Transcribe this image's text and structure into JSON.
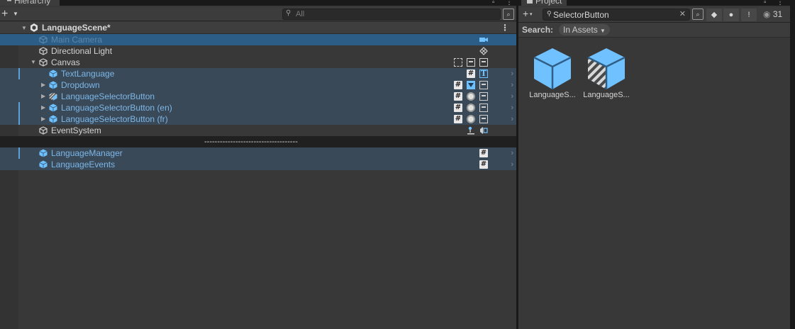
{
  "colors": {
    "panel_bg": "#383838",
    "selection": "#2c5d87",
    "highlight_row": "#3a4958",
    "prefab_blue": "#7cb7e8",
    "cube_blue": "#6fc1ff"
  },
  "hierarchy": {
    "tab_title": "Hierarchy",
    "search_placeholder": "All",
    "scene": {
      "name": "LanguageScene*",
      "icon": "unity-scene-icon"
    },
    "rows": [
      {
        "label": "Main Camera",
        "style": "dim",
        "icon": "gameobject-icon",
        "components": [
          "camera-icon"
        ]
      },
      {
        "label": "Directional Light",
        "style": "white",
        "icon": "gameobject-icon",
        "components": [
          "light-icon"
        ]
      },
      {
        "label": "Canvas",
        "style": "white",
        "icon": "gameobject-icon",
        "components": [
          "rect-transform-icon",
          "canvas-icon",
          "canvas-scaler-icon"
        ]
      },
      {
        "label": "TextLanguage",
        "style": "blue",
        "icon": "prefab-icon",
        "components": [
          "script-icon",
          "text-icon"
        ]
      },
      {
        "label": "Dropdown",
        "style": "blue",
        "icon": "prefab-icon",
        "components": [
          "script-icon",
          "dropdown-icon",
          "image-icon"
        ]
      },
      {
        "label": "LanguageSelectorButton",
        "style": "blue",
        "icon": "prefab-variant-icon",
        "components": [
          "script-icon",
          "toggle-icon",
          "image-icon"
        ]
      },
      {
        "label": "LanguageSelectorButton (en)",
        "style": "blue",
        "icon": "prefab-icon",
        "components": [
          "script-icon",
          "toggle-icon",
          "image-icon"
        ]
      },
      {
        "label": "LanguageSelectorButton (fr)",
        "style": "blue",
        "icon": "prefab-icon",
        "components": [
          "script-icon",
          "toggle-icon",
          "image-icon"
        ]
      },
      {
        "label": "EventSystem",
        "style": "white",
        "icon": "gameobject-icon",
        "components": [
          "event-system-icon",
          "input-module-icon"
        ]
      }
    ],
    "separator": "------------------------------------",
    "rows_after": [
      {
        "label": "LanguageManager",
        "style": "blue",
        "icon": "prefab-icon",
        "components": [
          "script-icon"
        ]
      },
      {
        "label": "LanguageEvents",
        "style": "blue",
        "icon": "prefab-icon",
        "components": [
          "script-icon"
        ]
      }
    ]
  },
  "project": {
    "tab_title": "Project",
    "search_value": "SelectorButton",
    "search_label": "Search:",
    "scope": "In Assets",
    "hidden_count": "31",
    "assets": [
      {
        "name": "LanguageS...",
        "type": "prefab"
      },
      {
        "name": "LanguageS...",
        "type": "prefab-variant"
      }
    ]
  }
}
